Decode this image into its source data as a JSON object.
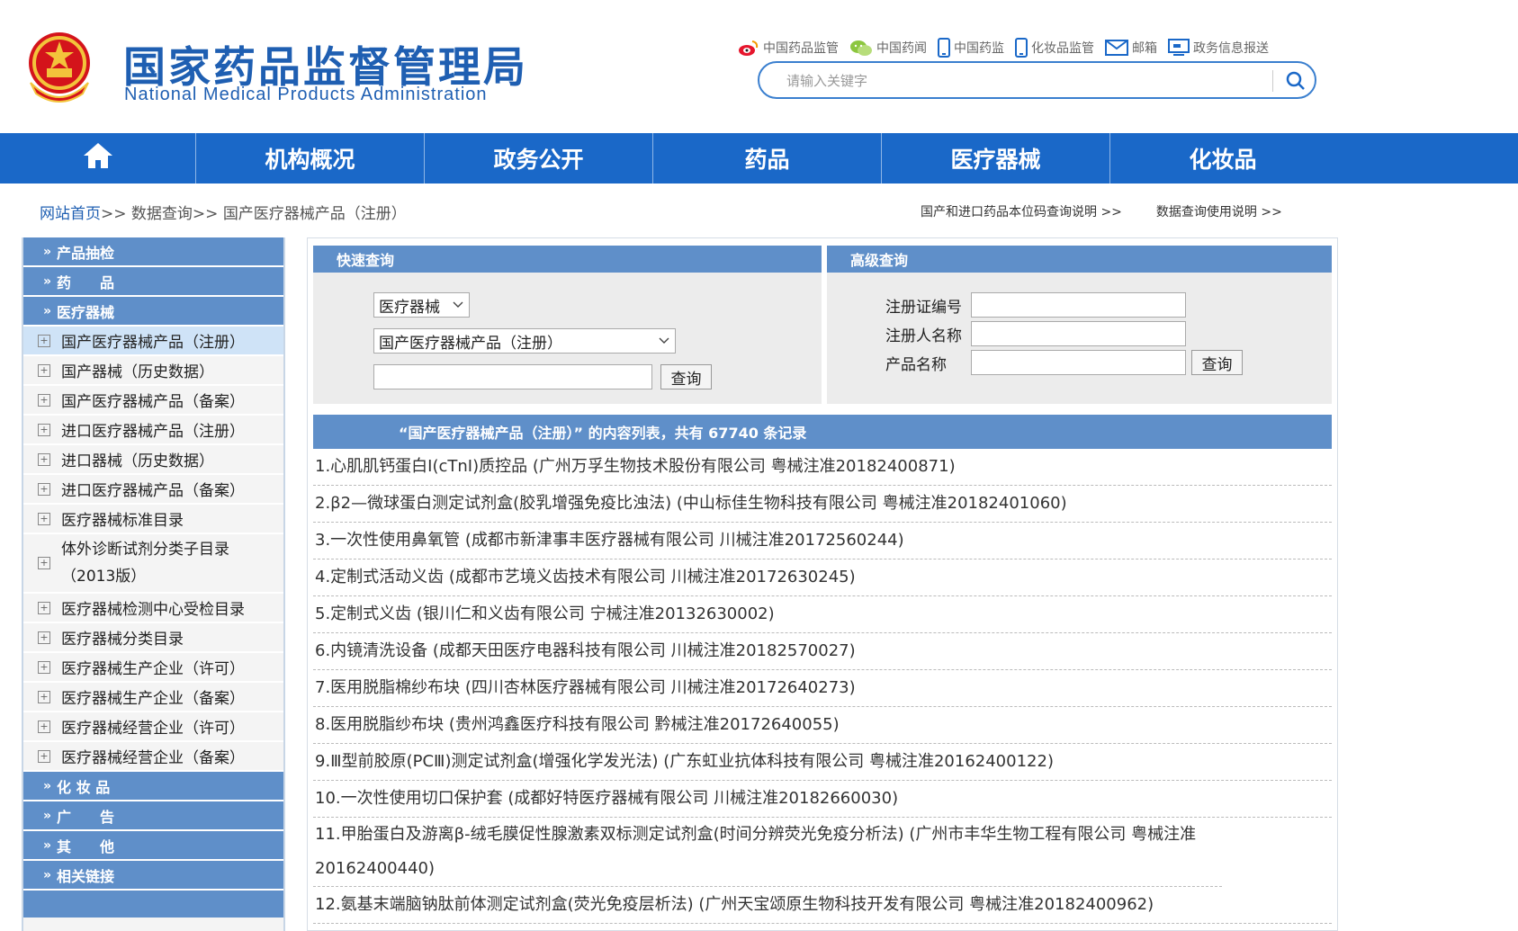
{
  "header": {
    "title_cn": "国家药品监督管理局",
    "title_en": "National Medical Products Administration",
    "quicklinks": [
      {
        "label": "中国药品监管",
        "icon": "weibo-icon"
      },
      {
        "label": "中国药闻",
        "icon": "wechat-icon"
      },
      {
        "label": "中国药监",
        "icon": "mobile-icon"
      },
      {
        "label": "化妆品监管",
        "icon": "mobile-icon"
      },
      {
        "label": "邮箱",
        "icon": "mail-icon"
      },
      {
        "label": "政务信息报送",
        "icon": "monitor-icon"
      }
    ],
    "search_placeholder": "请输入关键字"
  },
  "nav": {
    "items": [
      "机构概况",
      "政务公开",
      "药品",
      "医疗器械",
      "化妆品"
    ]
  },
  "breadcrumb": {
    "home": "网站首页",
    "sep": ">>",
    "level2": "数据查询",
    "level3": "国产医疗器械产品（注册）",
    "right_links": [
      "国产和进口药品本位码查询说明 >>",
      "数据查询使用说明 >>"
    ]
  },
  "sidebar": {
    "head_product_check": "产品抽检",
    "head_drugs": "药　　品",
    "head_devices": "医疗器械",
    "device_items": [
      "国产医疗器械产品（注册）",
      "国产器械（历史数据）",
      "国产医疗器械产品（备案）",
      "进口医疗器械产品（注册）",
      "进口器械（历史数据）",
      "进口医疗器械产品（备案）",
      "医疗器械标准目录",
      "体外诊断试剂分类子目录（2013版）",
      "医疗器械检测中心受检目录",
      "医疗器械分类目录",
      "医疗器械生产企业（许可）",
      "医疗器械生产企业（备案）",
      "医疗器械经营企业（许可）",
      "医疗器械经营企业（备案）"
    ],
    "head_cosmetics": "化 妆 品",
    "head_ads": "广　　告",
    "head_other": "其　　他",
    "head_links": "相关链接"
  },
  "quick_query": {
    "title": "快速查询",
    "category": "医疗器械",
    "database": "国产医疗器械产品（注册）",
    "keyword": "",
    "button": "查询"
  },
  "advanced_query": {
    "title": "高级查询",
    "label_reg_no": "注册证编号",
    "label_registrant": "注册人名称",
    "label_product": "产品名称",
    "button": "查询"
  },
  "results": {
    "header": "“国产医疗器械产品（注册）” 的内容列表，共有 67740 条记录",
    "rows": [
      "1.心肌肌钙蛋白I(cTnI)质控品 (广州万孚生物技术股份有限公司 粤械注准20182400871)",
      "2.β2—微球蛋白测定试剂盒(胶乳增强免疫比浊法) (中山标佳生物科技有限公司 粤械注准20182401060)",
      "3.一次性使用鼻氧管 (成都市新津事丰医疗器械有限公司 川械注准20172560244)",
      "4.定制式活动义齿 (成都市艺境义齿技术有限公司 川械注准20172630245)",
      "5.定制式义齿 (银川仁和义齿有限公司 宁械注准20132630002)",
      "6.内镜清洗设备 (成都天田医疗电器科技有限公司 川械注准20182570027)",
      "7.医用脱脂棉纱布块 (四川杏林医疗器械有限公司 川械注准20172640273)",
      "8.医用脱脂纱布块 (贵州鸿鑫医疗科技有限公司 黔械注准20172640055)",
      "9.Ⅲ型前胶原(PCⅢ)测定试剂盒(增强化学发光法) (广东虹业抗体科技有限公司 粤械注准20162400122)",
      "10.一次性使用切口保护套 (成都好特医疗器械有限公司 川械注准20182660030)",
      "11.甲胎蛋白及游离β-绒毛膜促性腺激素双标测定试剂盒(时间分辨荧光免疫分析法) (广州市丰华生物工程有限公司 粤械注准20162400440)",
      "12.氨基末端脑钠肽前体测定试剂盒(荧光免疫层析法) (广州天宝颂原生物科技开发有限公司 粤械注准20182400962)"
    ]
  },
  "colors": {
    "brand_blue": "#1a68c8",
    "panel_blue": "#5f8fc9",
    "title_blue": "#1f5fb2"
  }
}
